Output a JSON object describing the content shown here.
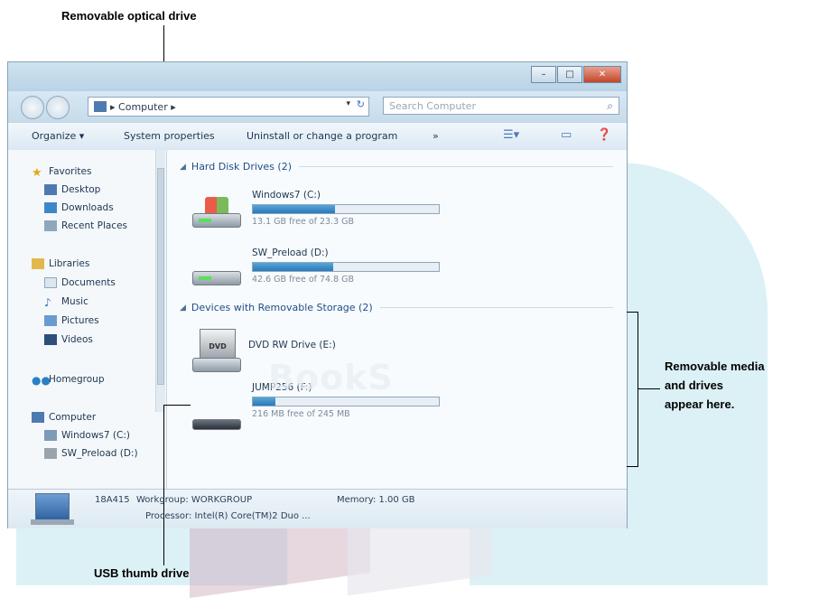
{
  "watermark": "BookS",
  "window": {
    "caption_buttons": [
      "–",
      "□",
      "✕"
    ],
    "address_path": [
      "Computer"
    ],
    "search_placeholder": "Search Computer"
  },
  "toolbar": {
    "organize": "Organize ▾",
    "system_properties": "System properties",
    "uninstall": "Uninstall or change a program",
    "more": "»"
  },
  "nav": {
    "favorites": "Favorites",
    "desktop": "Desktop",
    "downloads": "Downloads",
    "recent_places": "Recent Places",
    "libraries": "Libraries",
    "documents": "Documents",
    "music": "Music",
    "pictures": "Pictures",
    "videos": "Videos",
    "homegroup": "Homegroup",
    "computer": "Computer",
    "windows7_c": "Windows7 (C:)",
    "sw_preload_d": "SW_Preload (D:)"
  },
  "groups": {
    "hard_disk": "Hard Disk Drives (2)",
    "removable": "Devices with Removable Storage (2)"
  },
  "drives": {
    "c": {
      "name": "Windows7 (C:)",
      "free": "13.1 GB free of 23.3 GB",
      "fill": 0.44
    },
    "d": {
      "name": "SW_Preload (D:)",
      "free": "42.6 GB free of 74.8 GB",
      "fill": 0.43
    },
    "e": {
      "name": "DVD RW Drive (E:)"
    },
    "f": {
      "name": "JUMP256 (F:)",
      "free": "216 MB free of 245 MB",
      "fill": 0.12
    }
  },
  "details": {
    "pc_name": "18A415",
    "workgroup": "Workgroup: WORKGROUP",
    "memory": "Memory: 1.00 GB",
    "processor": "Processor: Intel(R) Core(TM)2 Duo ..."
  },
  "annotations": {
    "optical": "Removable optical drive",
    "usb": "USB thumb drive",
    "media_line1": "Removable media",
    "media_line2": "and drives",
    "media_line3": "appear here."
  }
}
